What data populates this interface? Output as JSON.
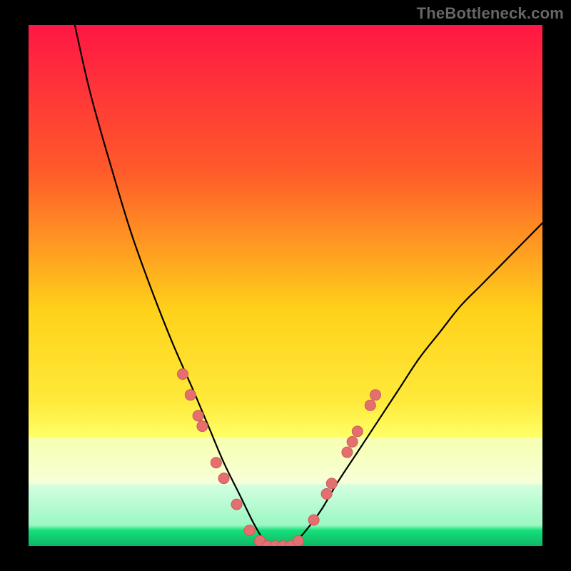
{
  "watermark": "TheBottleneck.com",
  "colors": {
    "bg": "#000000",
    "grad_top": "#ff1744",
    "grad_mid1": "#ff6a2a",
    "grad_mid2": "#ffd21a",
    "grad_mid3": "#ffff55",
    "grad_mid4": "#f7ffb0",
    "grad_bottom_top": "#c8ffcc",
    "grad_green": "#14e07a",
    "curve": "#000000",
    "dot_fill": "#e56f6f",
    "dot_stroke": "#c85a5a"
  },
  "chart_data": {
    "type": "line",
    "title": "",
    "xlabel": "",
    "ylabel": "",
    "x_range": [
      0,
      100
    ],
    "y_range": [
      0,
      100
    ],
    "curve_description": "V-shaped bottleneck curve; minimum (0) in a flat trough roughly at x≈44–52; left branch rises steeply to ~100 at x≈9; right branch rises to ~62 at x=100",
    "series": [
      {
        "name": "bottleneck_curve",
        "x": [
          9,
          12,
          16,
          20,
          24,
          28,
          32,
          35,
          38,
          41,
          44,
          46,
          48,
          50,
          52,
          54,
          57,
          60,
          64,
          68,
          72,
          76,
          80,
          84,
          88,
          92,
          96,
          100
        ],
        "y": [
          100,
          87,
          73,
          60,
          49,
          39,
          30,
          23,
          16,
          10,
          4,
          1,
          0,
          0,
          1,
          3,
          7,
          12,
          18,
          24,
          30,
          36,
          41,
          46,
          50,
          54,
          58,
          62
        ]
      }
    ],
    "dots_description": "Highlighted sample points (pink) along each branch and across trough",
    "dots": [
      {
        "x": 30.0,
        "y": 33
      },
      {
        "x": 31.5,
        "y": 29
      },
      {
        "x": 33.0,
        "y": 25
      },
      {
        "x": 33.8,
        "y": 23
      },
      {
        "x": 36.5,
        "y": 16
      },
      {
        "x": 38.0,
        "y": 13
      },
      {
        "x": 40.5,
        "y": 8
      },
      {
        "x": 43.0,
        "y": 3
      },
      {
        "x": 45.0,
        "y": 1
      },
      {
        "x": 46.5,
        "y": 0
      },
      {
        "x": 48.0,
        "y": 0
      },
      {
        "x": 49.5,
        "y": 0
      },
      {
        "x": 51.0,
        "y": 0
      },
      {
        "x": 52.5,
        "y": 1
      },
      {
        "x": 55.5,
        "y": 5
      },
      {
        "x": 58.0,
        "y": 10
      },
      {
        "x": 59.0,
        "y": 12
      },
      {
        "x": 62.0,
        "y": 18
      },
      {
        "x": 63.0,
        "y": 20
      },
      {
        "x": 64.0,
        "y": 22
      },
      {
        "x": 66.5,
        "y": 27
      },
      {
        "x": 67.5,
        "y": 29
      }
    ],
    "gradient_bands_y": {
      "red_to_yellow_fade": "0 → ~78",
      "pale_yellow_band": "~78 → ~88",
      "pale_green_band": "~88 → ~97",
      "green_line": "~97 → 100"
    }
  }
}
